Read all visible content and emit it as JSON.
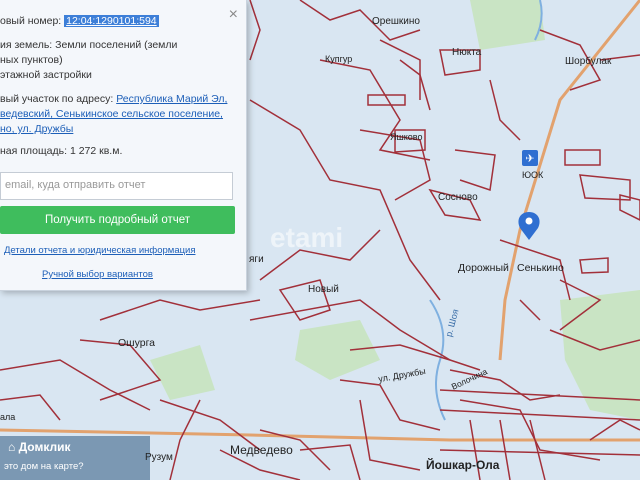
{
  "panel": {
    "cadastral_label": "овый номер:",
    "cadastral_number": "12:04:1290101:594",
    "land_cat_label": "ия земель:",
    "land_cat_value_1": "Земли поселений (земли",
    "land_cat_value_2": "ных пунктов)",
    "land_cat_value_3": "этажной застройки",
    "address_label": "вый участок по адресу:",
    "address_1": "Республика Марий Эл,",
    "address_2": "ведевский, Сенькинское сельское поселение,",
    "address_3": "но, ул. Дружбы",
    "area_label": "ная площадь:",
    "area_value": "1 272 кв.м.",
    "email_placeholder": "email, куда отправить отчет",
    "report_button": "Получить подробный отчет",
    "details_link": "Детали отчета и юридическая информация",
    "manual_link": "Ручной выбор вариантов",
    "close": "×"
  },
  "map": {
    "labels": {
      "oreshkino": "Орешкино",
      "nyukta": "Нюкта",
      "shorbulak": "Шорбулак",
      "kuptur": "Купгур",
      "yashkovo": "Яшково",
      "yok": "ЮОК",
      "sosnovo": "Сосново",
      "dorozhny": "Дорожный",
      "senkino": "Сенькино",
      "yagi": "яги",
      "novy": "Новый",
      "oshurga": "Ошурга",
      "shoya": "р. Шоя",
      "druzhby": "ул. Дружбы",
      "voloshina": "Волочина",
      "medvedevo": "Медведево",
      "ruzum": "Рузум",
      "yoshkar_ola": "Йошкар-Ола",
      "ala": "ала",
      "watermark": "etami"
    },
    "colors": {
      "background": "#d9e6f2",
      "boundary": "#a2303a",
      "road": "#e0a070",
      "green": "#bfe0b0"
    }
  },
  "branding": {
    "name": "Домклик",
    "question": "это дом на карте?"
  }
}
